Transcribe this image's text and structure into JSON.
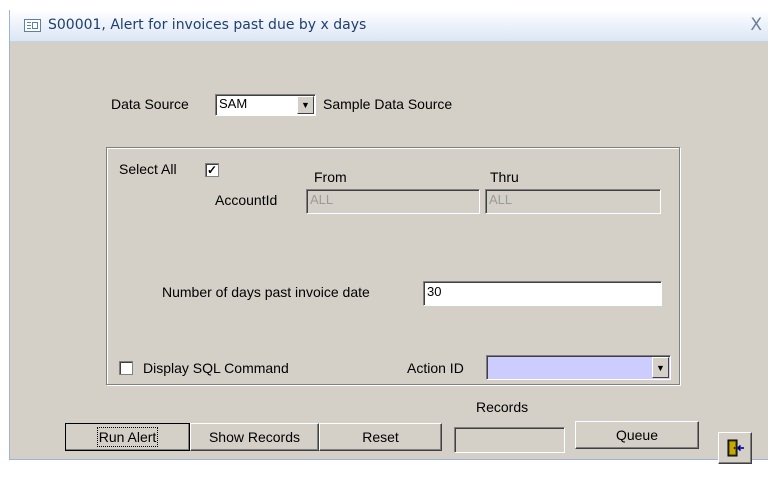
{
  "window": {
    "title": "S00001, Alert for invoices past due by x days",
    "close_symbol": "X"
  },
  "data_source": {
    "label": "Data Source",
    "value": "SAM",
    "description": "Sample Data Source"
  },
  "filters": {
    "select_all_label": "Select All",
    "select_all_checked": true,
    "from_header": "From",
    "thru_header": "Thru",
    "account_label": "AccountId",
    "account_from": "ALL",
    "account_thru": "ALL",
    "days_label": "Number of days past invoice date",
    "days_value": "30",
    "display_sql_label": "Display SQL Command",
    "display_sql_checked": false,
    "action_label": "Action ID",
    "action_value": ""
  },
  "records_label": "Records",
  "records_value": "",
  "buttons": {
    "run_alert": "Run Alert",
    "show_records": "Show Records",
    "reset": "Reset",
    "queue": "Queue"
  },
  "icons": {
    "exit": "exit-door-icon",
    "form": "form-icon",
    "checkmark": "✓"
  },
  "colors": {
    "form_bg": "#d4d0c8",
    "action_field_bg": "#ccccff",
    "title_text": "#1f3f6f"
  }
}
